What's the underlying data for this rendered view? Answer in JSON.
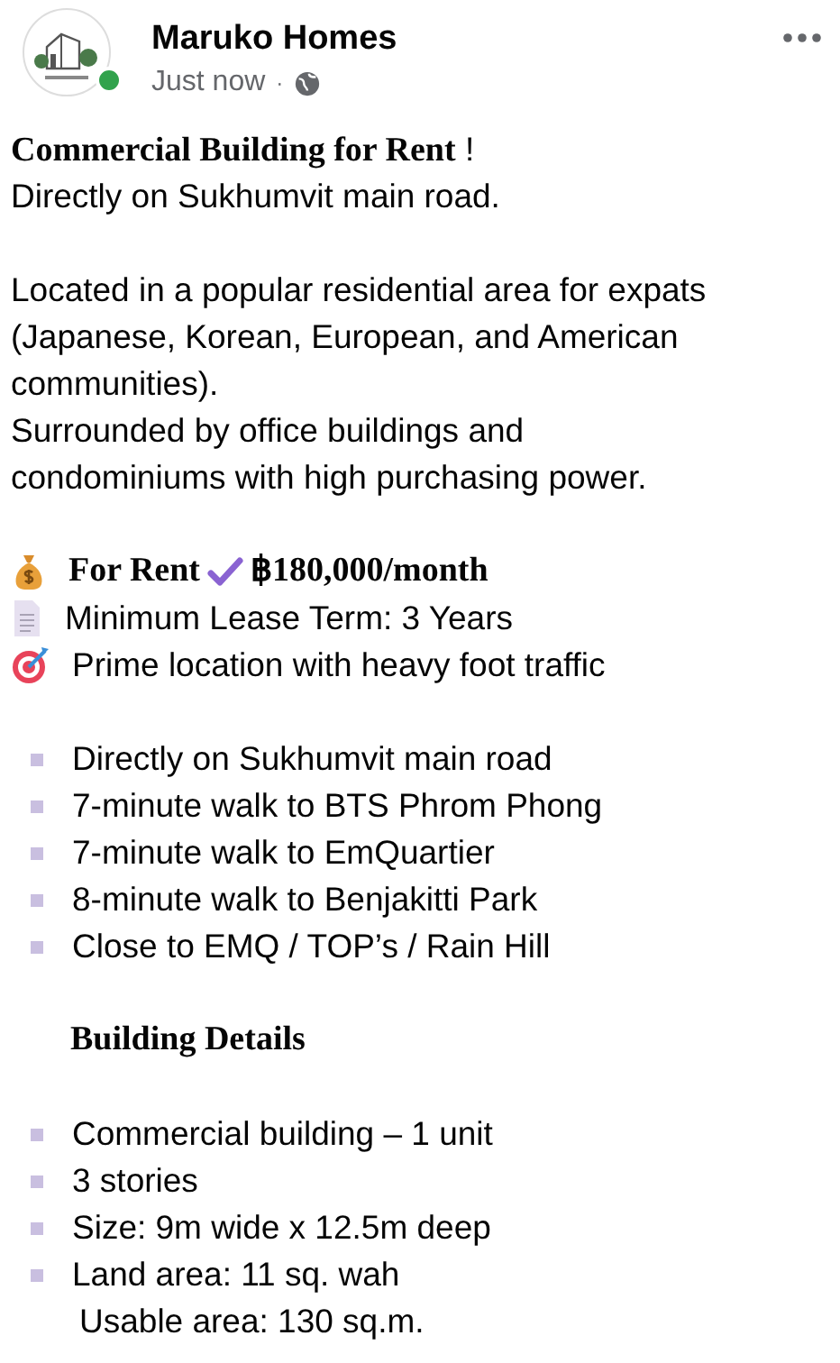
{
  "post": {
    "author": "Maruko Homes",
    "time": "Just now",
    "separator": "·",
    "online": true
  },
  "lines": [
    {
      "kind": "text",
      "text": "**Commercial Building for Rent** !"
    },
    {
      "kind": "text",
      "text": "Directly on Sukhumvit main road."
    },
    {
      "kind": "blank"
    },
    {
      "kind": "text",
      "text": "Located in a popular residential area for expats"
    },
    {
      "kind": "text",
      "text": "(Japanese, Korean, European, and American"
    },
    {
      "kind": "text",
      "text": "communities)."
    },
    {
      "kind": "text",
      "text": "Surrounded by office buildings and"
    },
    {
      "kind": "text",
      "text": "condominiums with high purchasing power."
    },
    {
      "kind": "blank"
    },
    {
      "kind": "price",
      "label": "For Rent",
      "value": "฿180,000/month"
    },
    {
      "kind": "icon",
      "text": "Minimum Lease Term: 3 Years"
    },
    {
      "kind": "icon",
      "text": "Prime location with heavy foot traffic"
    },
    {
      "kind": "blank"
    },
    {
      "kind": "bullet",
      "text": "Directly on Sukhumvit main road"
    },
    {
      "kind": "bullet",
      "text": "7-minute walk to BTS Phrom Phong"
    },
    {
      "kind": "bullet",
      "text": "7-minute walk to EmQuartier"
    },
    {
      "kind": "bullet",
      "text": "8-minute walk to Benjakitti Park"
    },
    {
      "kind": "bullet",
      "text": "Close to EMQ / TOP’s / Rain Hill"
    },
    {
      "kind": "blank"
    },
    {
      "kind": "heading",
      "text": "Building Details"
    },
    {
      "kind": "blank"
    },
    {
      "kind": "bullet",
      "text": "Commercial building – 1 unit"
    },
    {
      "kind": "bullet",
      "text": "3 stories"
    },
    {
      "kind": "bullet",
      "text": "Size: 9m wide x 12.5m deep"
    },
    {
      "kind": "bullet",
      "text": "Land area: 11 sq. wah"
    },
    {
      "kind": "indent",
      "text": "Usable area: 130 sq.m."
    }
  ]
}
